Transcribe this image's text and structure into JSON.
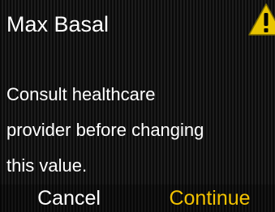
{
  "header": {
    "title": "Max Basal",
    "warning_icon": "warning-triangle-icon",
    "warning_color": "#e8c400"
  },
  "message": {
    "lines": [
      "Consult healthcare",
      "provider before changing",
      "this value."
    ]
  },
  "footer": {
    "cancel_label": "Cancel",
    "continue_label": "Continue",
    "continue_color": "#f2c200"
  }
}
